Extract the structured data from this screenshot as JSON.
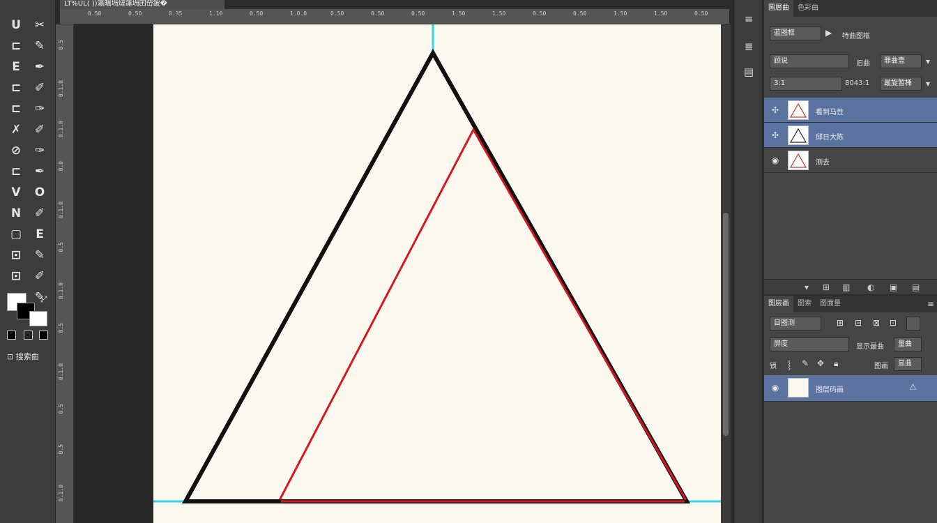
{
  "document_tab": {
    "title": "LT%UL( ))瀛曞堝燵蓮堝囨嵤鈹�"
  },
  "ruler_top_ticks": [
    "0.50",
    "0.50",
    "0.35",
    "1.10",
    "0.50",
    "1.0.0",
    "0.50",
    "0.50",
    "0.50",
    "1.50",
    "1.50",
    "0.50",
    "0.50",
    "1.50",
    "1.50",
    "0.50"
  ],
  "ruler_left_ticks": [
    "0.5",
    "0.1.0",
    "0.1.0",
    "0.0",
    "0.1.0",
    "0.5",
    "0.1.0",
    "0.5",
    "0.1.0",
    "0.5",
    "0.5",
    "0.1.0"
  ],
  "toolbar": {
    "tools": [
      "U",
      "✂",
      "⊏",
      "✎",
      "E",
      "✒",
      "⊏",
      "✐",
      "⊏",
      "✑",
      "✗",
      "✐",
      "⊘",
      "✑",
      "⊏",
      "✒",
      "V",
      "O",
      "N",
      "✐",
      "▢",
      "E",
      "⊡",
      "✎",
      "⊡",
      "✐",
      "⊆",
      "✎"
    ],
    "quick_mask_label": "⊡ 搜索曲"
  },
  "side_strip": {
    "icons": [
      "≡",
      "≣",
      "▤"
    ]
  },
  "upper_panel": {
    "tabs": [
      "圖層曲",
      "色彩曲"
    ],
    "mode_field": "蓝图框",
    "mode_right": "特曲图框",
    "blend_field": "顾说",
    "blend_label": "旧曲",
    "opacity_field": "罪曲壹",
    "fill_field": "3:1",
    "fill_label": "8043:1",
    "lock_field": "最旋暂桶",
    "layers": [
      {
        "name": "看到马性",
        "selected": true,
        "visible_icon": "✣"
      },
      {
        "name": "邱日大陈",
        "selected": true,
        "visible_icon": "✣"
      },
      {
        "name": "测去",
        "selected": false,
        "visible_icon": "◉"
      }
    ],
    "footer_icons": [
      "▾",
      "⊞",
      "▥",
      "◐",
      "▣",
      "▤"
    ]
  },
  "lower_panel": {
    "tabs": [
      "图层画",
      "图索",
      "图面量"
    ],
    "kind_field": "目图测",
    "kind_icons": [
      "⊞",
      "⊟",
      "⊠",
      "⊡"
    ],
    "blend_field": "屏度",
    "blend_label": "显示最曲",
    "blend_value": "量曲",
    "lock_label": "锁",
    "lock_right": "图画",
    "fill_value": "显曲",
    "layer": {
      "name": "图层码画",
      "warn_icon": "⚠"
    }
  },
  "colors": {
    "accent_selected_row": "#5b73a0",
    "guide_cyan": "#33d6e6",
    "outer_triangle": "#111111",
    "inner_triangle": "#d41820",
    "canvas": "#fbf9ef"
  }
}
